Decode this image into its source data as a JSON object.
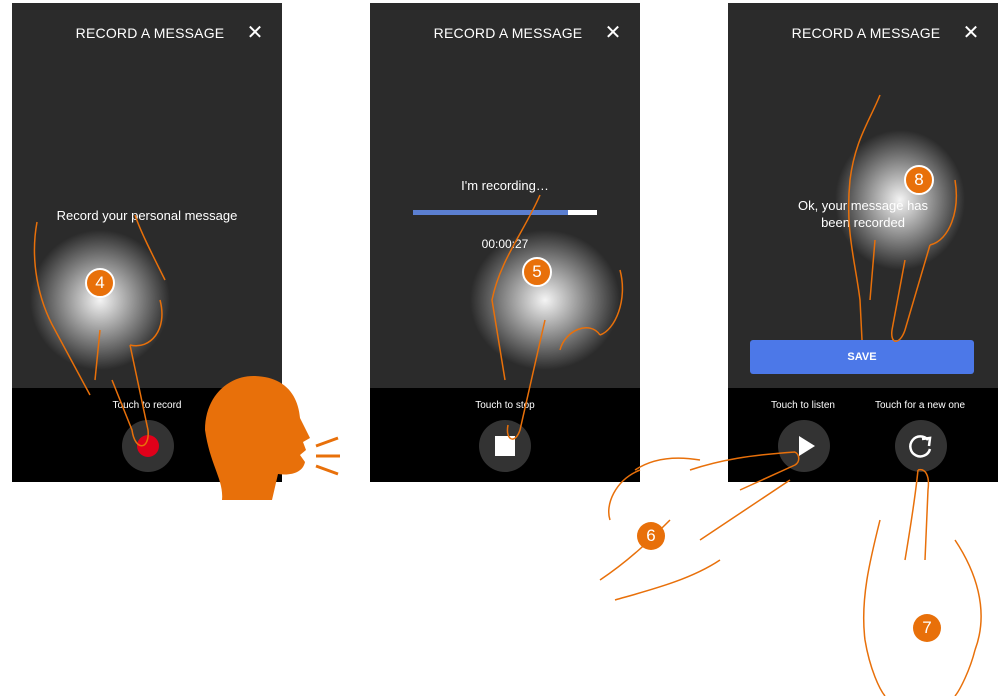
{
  "screens": [
    {
      "title": "RECORD A MESSAGE",
      "message": "Record your personal message",
      "hint": "Touch to record",
      "step": "4"
    },
    {
      "title": "RECORD A MESSAGE",
      "message": "I'm recording…",
      "timer": "00:00:27",
      "progress": 0.84,
      "hint": "Touch to stop",
      "step": "5"
    },
    {
      "title": "RECORD A MESSAGE",
      "message_line1": "Ok, your message has",
      "message_line2": "been recorded",
      "save_label": "SAVE",
      "listen_hint": "Touch to listen",
      "new_hint": "Touch for a new one",
      "step": "8"
    }
  ],
  "steps_outside": {
    "listen_step": "6",
    "new_step": "7"
  },
  "colors": {
    "accent": "#e8700a",
    "record_red": "#e0001a",
    "save_blue": "#4c78e8",
    "progress": "#5b7fd1"
  },
  "icons": [
    "close-icon",
    "record-icon",
    "stop-icon",
    "play-icon",
    "refresh-icon",
    "speaking-head-icon",
    "pointing-hand-icon"
  ]
}
